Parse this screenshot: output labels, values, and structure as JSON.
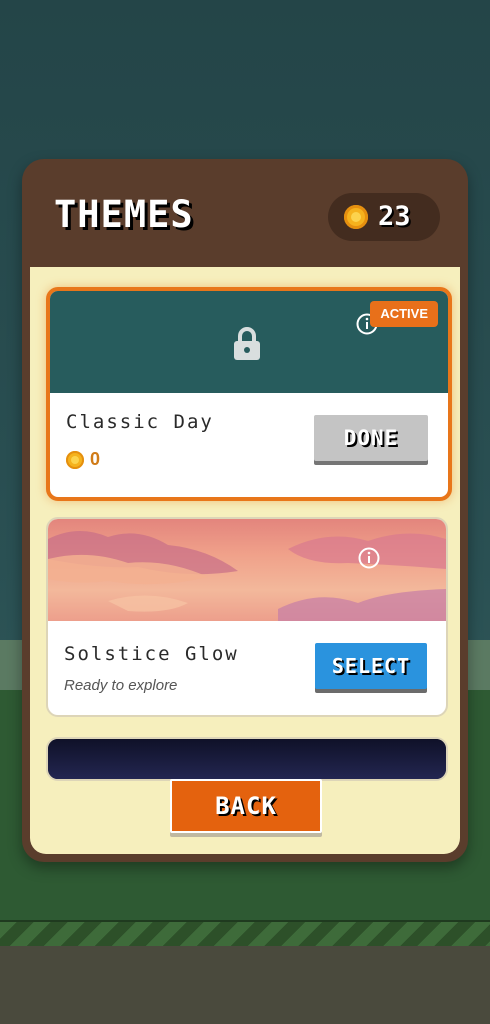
{
  "header": {
    "title": "THEMES",
    "coins": "23"
  },
  "themes": [
    {
      "name": "Classic Day",
      "badge": "ACTIVE",
      "price": "0",
      "button_label": "DONE",
      "locked": true
    },
    {
      "name": "Solstice Glow",
      "status": "Ready to explore",
      "button_label": "SELECT"
    }
  ],
  "footer": {
    "back_label": "BACK"
  },
  "colors": {
    "accent_orange": "#e8701a",
    "select_blue": "#2a93de",
    "panel_brown": "#5a3d2c",
    "panel_cream": "#f6efbd"
  }
}
